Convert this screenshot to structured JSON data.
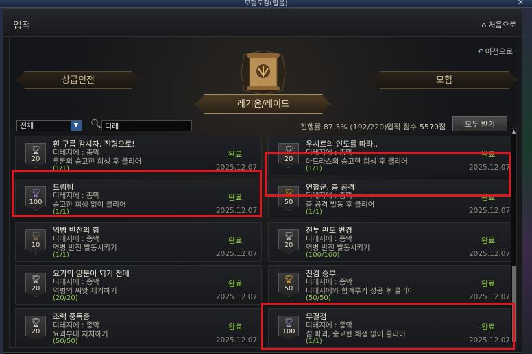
{
  "window_title": "모험도감(업음)",
  "header": {
    "title": "업적",
    "home_label": "처음으로"
  },
  "prev_label": "이전으로",
  "tabs": {
    "left": "상급던전",
    "center": "레기온/레이드",
    "right": "모험"
  },
  "filter": {
    "selected": "전체"
  },
  "search": {
    "value": "디레"
  },
  "progress_text": "진행률 87.3% (192/220)",
  "score_label": "업적 점수",
  "score_value": "5570점",
  "receive_all": "모두 받기",
  "colors": {
    "highlight": "#e0161c",
    "complete": "#8fd13e",
    "progress": "#8fc44e"
  },
  "cards": [
    {
      "name": "흰 구름 감시자, 진형으로!",
      "cond1": "디레지에 : 종막",
      "cond2": "루톤의 숭고한 희생 후 클리어",
      "progress": "(1/1)",
      "status": "완료",
      "date": "2025.12.07",
      "points": "20",
      "trophy": "silver"
    },
    {
      "name": "우시르의 인도를 따라..",
      "cond1": "디레지에 : 종막",
      "cond2": "아드라스의 숭고한 희생 후 클리어",
      "progress": "(1/1)",
      "status": "완료",
      "date": "2025.12.07",
      "points": "20",
      "trophy": "silver"
    },
    {
      "name": "드림팀",
      "cond1": "디레지에 : 종막",
      "cond2": "숭고한 희생 없이 클리어",
      "progress": "(1/1)",
      "status": "완료",
      "date": "2025.12.07",
      "points": "100",
      "trophy": "purple"
    },
    {
      "name": "연합군, 총 공격!",
      "cond1": "디레지에 : 종막",
      "cond2": "총 공격 발동 후 클리어",
      "progress": "(1/1)",
      "status": "완료",
      "date": "2025.12.07",
      "points": "50",
      "trophy": "gold"
    },
    {
      "name": "역병 반전의 힘",
      "cond1": "디레지에 : 종막",
      "cond2": "역병 반전 발동시키기",
      "progress": "(1/1)",
      "status": "완료",
      "date": "2025.12.07",
      "points": "10",
      "trophy": "bronze"
    },
    {
      "name": "전투 판도 변경",
      "cond1": "디레지에 : 종막",
      "cond2": "역병 반전 발동시키기",
      "progress": "(100/100)",
      "status": "완료",
      "date": "2025.12.07",
      "points": "20",
      "trophy": "silver"
    },
    {
      "name": "요기의 양분이 되기 전에",
      "cond1": "디레지에 : 종막",
      "cond2": "역병의 씨앗 제거하기",
      "progress": "(20/20)",
      "status": "완료",
      "date": "2025.12.07",
      "points": "20",
      "trophy": "silver"
    },
    {
      "name": "진검 승부",
      "cond1": "디레지에 : 종막",
      "cond2": "디레지에와 힘겨루기 성공 후 클리어",
      "progress": "(50/50)",
      "status": "완료",
      "date": "2025.12.07",
      "points": "50",
      "trophy": "gold"
    },
    {
      "name": "조력 중독증",
      "cond1": "디레지에 : 종막",
      "cond2": "요괴부대 처치하기",
      "progress": "(50/50)",
      "status": "완료",
      "date": "2025.12.07",
      "points": "20",
      "trophy": "silver"
    },
    {
      "name": "무결점",
      "cond1": "디레지에 : 종막",
      "cond2": "섬 파괴, 숭고한 희생 없이 클리어",
      "progress": "(1/1)",
      "status": "완료",
      "date": "2025.12.07",
      "points": "100",
      "trophy": "purple"
    }
  ]
}
